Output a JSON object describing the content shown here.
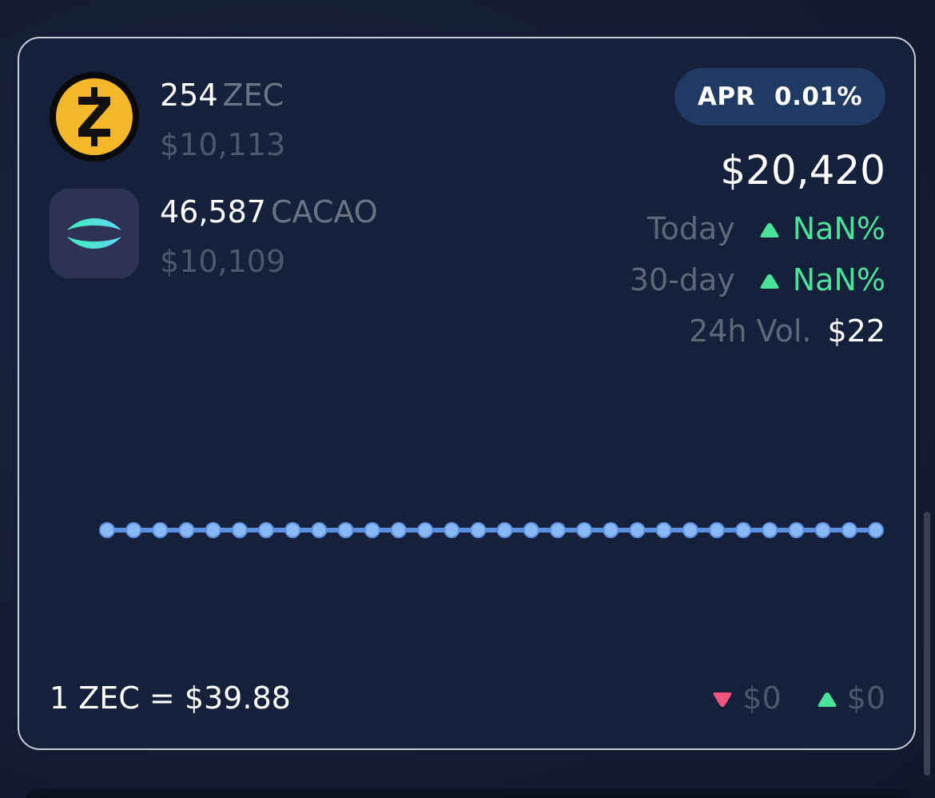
{
  "assets": [
    {
      "icon": "zec-icon",
      "amount": "254",
      "symbol": "ZEC",
      "usd": "$10,113"
    },
    {
      "icon": "cacao-icon",
      "amount": "46,587",
      "symbol": "CACAO",
      "usd": "$10,109"
    }
  ],
  "apr": {
    "label": "APR",
    "value": "0.01%"
  },
  "total_value": "$20,420",
  "stats": {
    "today": {
      "label": "Today",
      "value": "NaN%",
      "direction": "up"
    },
    "thirty_day": {
      "label": "30-day",
      "value": "NaN%",
      "direction": "up"
    },
    "volume": {
      "label": "24h Vol.",
      "value": "$22"
    }
  },
  "rate": "1 ZEC = $39.88",
  "range": {
    "low": {
      "value": "$0",
      "direction": "down"
    },
    "high": {
      "value": "$0",
      "direction": "up"
    }
  },
  "colors": {
    "card_bg": "#15213b",
    "border": "#c7ccd6",
    "accent_green": "#4be39a",
    "accent_pink": "#f2557e",
    "line": "#5b8fe0",
    "point": "#8ab8f5",
    "muted": "#5f6779"
  },
  "chart_data": {
    "type": "line",
    "x": [
      1,
      2,
      3,
      4,
      5,
      6,
      7,
      8,
      9,
      10,
      11,
      12,
      13,
      14,
      15,
      16,
      17,
      18,
      19,
      20,
      21,
      22,
      23,
      24,
      25,
      26,
      27,
      28,
      29,
      30
    ],
    "series": [
      {
        "values": [
          39.88,
          39.88,
          39.88,
          39.88,
          39.88,
          39.88,
          39.88,
          39.88,
          39.88,
          39.88,
          39.88,
          39.88,
          39.88,
          39.88,
          39.88,
          39.88,
          39.88,
          39.88,
          39.88,
          39.88,
          39.88,
          39.88,
          39.88,
          39.88,
          39.88,
          39.88,
          39.88,
          39.88,
          39.88,
          39.88
        ]
      }
    ],
    "title": "",
    "xlabel": "",
    "ylabel": "",
    "grid": false
  }
}
